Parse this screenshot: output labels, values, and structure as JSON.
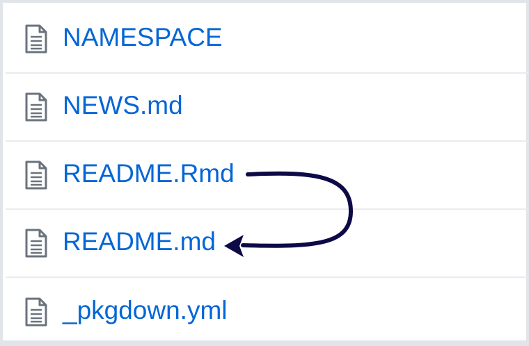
{
  "files": [
    {
      "name": "NAMESPACE",
      "icon": "file-text-icon"
    },
    {
      "name": "NEWS.md",
      "icon": "file-text-icon"
    },
    {
      "name": "README.Rmd",
      "icon": "file-text-icon"
    },
    {
      "name": "README.md",
      "icon": "file-text-icon"
    },
    {
      "name": "_pkgdown.yml",
      "icon": "file-text-icon"
    }
  ],
  "colors": {
    "link": "#0366d6",
    "icon": "#6a737d",
    "arrow": "#0d0a47",
    "divider": "#e9ebee"
  }
}
